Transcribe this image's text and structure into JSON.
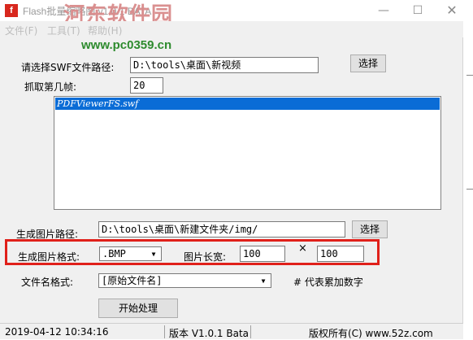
{
  "window": {
    "title": "Flash批量缩略图 v1.0.1 BATA",
    "min_symbol": "—",
    "max_symbol": "☐",
    "close_symbol": "✕"
  },
  "watermark": {
    "title": "河东软件园",
    "url": "www.pc0359.cn"
  },
  "menu": {
    "items": [
      "文件(F)",
      "工具(T)",
      "帮助(H)"
    ]
  },
  "form": {
    "swf_path_label": "请选择SWF文件路径:",
    "swf_path_value": "D:\\tools\\桌面\\新视频",
    "select_button_1": "选择",
    "frame_label": "抓取第几帧:",
    "frame_value": "20",
    "file_list": [
      "PDFViewerFS.swf"
    ],
    "output_path_label": "生成图片路径:",
    "output_path_value": "D:\\tools\\桌面\\新建文件夹/img/",
    "select_button_2": "选择",
    "format_label": "生成图片格式:",
    "format_value": ".BMP",
    "size_label": "图片长宽:",
    "width_value": "100",
    "times_symbol": "×",
    "height_value": "100",
    "filename_label": "文件名格式:",
    "filename_value": "[原始文件名]",
    "filename_hint": "# 代表累加数字",
    "start_button": "开始处理"
  },
  "status": {
    "datetime": "2019-04-12 10:34:16",
    "version": "版本 V1.0.1 Bata",
    "copyright": "版权所有(C) www.52z.com"
  },
  "colors": {
    "highlight_border": "#e0201a",
    "selection": "#0a6cd6"
  }
}
